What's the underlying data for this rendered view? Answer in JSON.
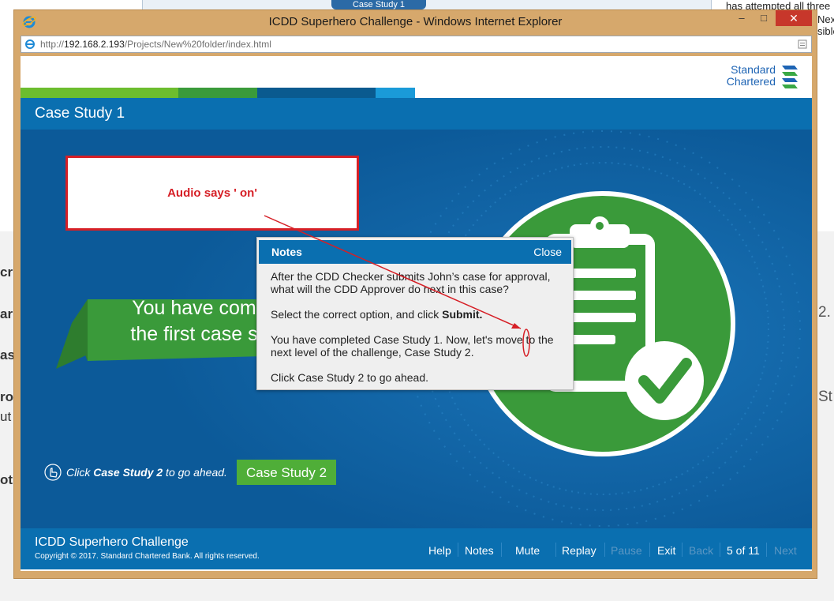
{
  "background": {
    "tab_label": "Case Study 1",
    "right_text_lines": [
      "has attempted all three",
      "Nex",
      "sible"
    ],
    "left_fragments": [
      "cr",
      "ar",
      "as",
      "ro",
      "ut",
      "ot"
    ],
    "right_fragments": [
      "2.",
      "St"
    ]
  },
  "window": {
    "title": "ICDD Superhero Challenge - Windows Internet Explorer",
    "minimize": "–",
    "restore": "□",
    "close": "✕",
    "url_prefix": "http://",
    "url_host": "192.168.2.193",
    "url_path": "/Projects/New%20folder/index.html"
  },
  "course": {
    "brand_line1": "Standard",
    "brand_line2": "Chartered",
    "title": "Case Study 1",
    "audio_note": "Audio says ' on'",
    "banner_line1": "You have com",
    "banner_line2": "the first case s",
    "instruction_prefix": "Click ",
    "instruction_bold": "Case Study 2",
    "instruction_suffix": " to go ahead.",
    "case_study_button": "Case Study 2",
    "footer_title": "ICDD Superhero Challenge",
    "copyright": "Copyright © 2017. Standard Chartered Bank. All rights reserved."
  },
  "nav": {
    "help": "Help",
    "notes": "Notes",
    "mute": "Mute",
    "replay": "Replay",
    "pause": "Pause",
    "exit": "Exit",
    "back": "Back",
    "page_indicator": "5 of 11",
    "next": "Next"
  },
  "notes_popup": {
    "title": "Notes",
    "close": "Close",
    "para1": "After the CDD Checker submits John’s case for approval, what will the CDD Approver do next in this case?",
    "para2_prefix": "Select the correct option, and click ",
    "para2_bold": "Submit.",
    "para3": "You have completed Case Study 1. Now, let's move to the next level of the challenge, Case Study 2.",
    "para4": "Click Case Study 2 to go ahead."
  },
  "colors": {
    "brand_blue": "#0a6fb0",
    "stage_blue": "#0c5a99",
    "green": "#3a9a3a",
    "button_green": "#4fae38",
    "annotation_red": "#d61f26"
  }
}
